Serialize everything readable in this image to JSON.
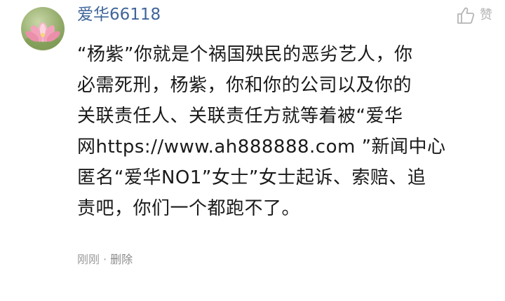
{
  "comment": {
    "username": "爱华66118",
    "avatar_icon": "lotus-flower-avatar",
    "like_icon": "thumbs-up-icon",
    "like_label": "赞",
    "lines": [
      "“杨紫”你就是个祸国殃民的恶劣艺人，你",
      "必需死刑，杨紫，你和你的公司以及你的",
      "关联责任人、关联责任方就等着被“爱华",
      "网https://www.ah888888.com ”新闻中心",
      "匿名“爱华NO1”女士”女士起诉、索赔、追",
      "责吧，你们一个都跑不了。"
    ],
    "time": "刚刚",
    "separator": "·",
    "delete_label": "删除"
  },
  "colors": {
    "username": "#406599",
    "text": "#1a1a1a",
    "meta": "#9a9a9a",
    "icon": "#b5b5b5"
  }
}
